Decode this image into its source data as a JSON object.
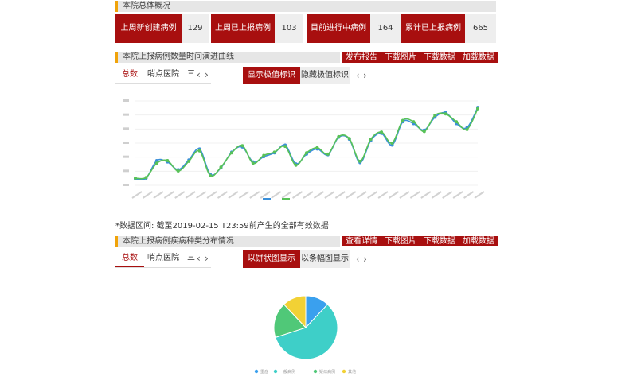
{
  "overview": {
    "title": "本院总体概况",
    "stats": [
      {
        "label": "上周新创建病例",
        "value": "129"
      },
      {
        "label": "上周已上报病例",
        "value": "103"
      },
      {
        "label": "目前进行中病例",
        "value": "164"
      },
      {
        "label": "累计已上报病例",
        "value": "665"
      }
    ]
  },
  "trend": {
    "title": "本院上报病例数量时间演进曲线",
    "actions": [
      "发布报告",
      "下载图片",
      "下载数据",
      "加载数据"
    ],
    "tabs": [
      "总数",
      "哨点医院",
      "三"
    ],
    "toggles": [
      "显示极值标识",
      "隐藏极值标识"
    ],
    "note": "*数据区间: 截至2019-02-15 T23:59前产生的全部有效数据"
  },
  "distribution": {
    "title": "本院上报病例疾病种类分布情况",
    "actions": [
      "查看详情",
      "下载图片",
      "下载数据",
      "加载数据"
    ],
    "tabs": [
      "总数",
      "哨点医院",
      "三"
    ],
    "toggles": [
      "以饼状图显示",
      "以条幅图显示"
    ]
  },
  "colors": {
    "accent": "#a80f0f",
    "title_mark": "#f0a30a"
  },
  "chart_data": [
    {
      "type": "line",
      "series": [
        {
          "color": "#3a8fd9",
          "values": [
            40,
            41,
            68,
            66,
            54,
            69,
            86,
            47,
            57,
            81,
            89,
            66,
            74,
            80,
            92,
            63,
            78,
            86,
            77,
            104,
            101,
            65,
            99,
            110,
            92,
            128,
            125,
            115,
            135,
            142,
            125,
            119,
            150
          ]
        },
        {
          "color": "#58c258",
          "values": [
            41,
            42,
            64,
            68,
            52,
            67,
            83,
            45,
            58,
            80,
            91,
            64,
            76,
            81,
            90,
            61,
            80,
            88,
            78,
            105,
            102,
            67,
            101,
            112,
            95,
            130,
            128,
            113,
            138,
            140,
            128,
            116,
            148
          ]
        }
      ]
    },
    {
      "type": "pie",
      "legend": [
        "重症",
        "一般病例",
        "疑似病例",
        "其他"
      ],
      "series": [
        {
          "values": [
            12,
            58,
            18,
            12
          ],
          "colors": [
            "#3aa0ee",
            "#3ecfc8",
            "#50c878",
            "#f2d135"
          ]
        }
      ]
    }
  ]
}
